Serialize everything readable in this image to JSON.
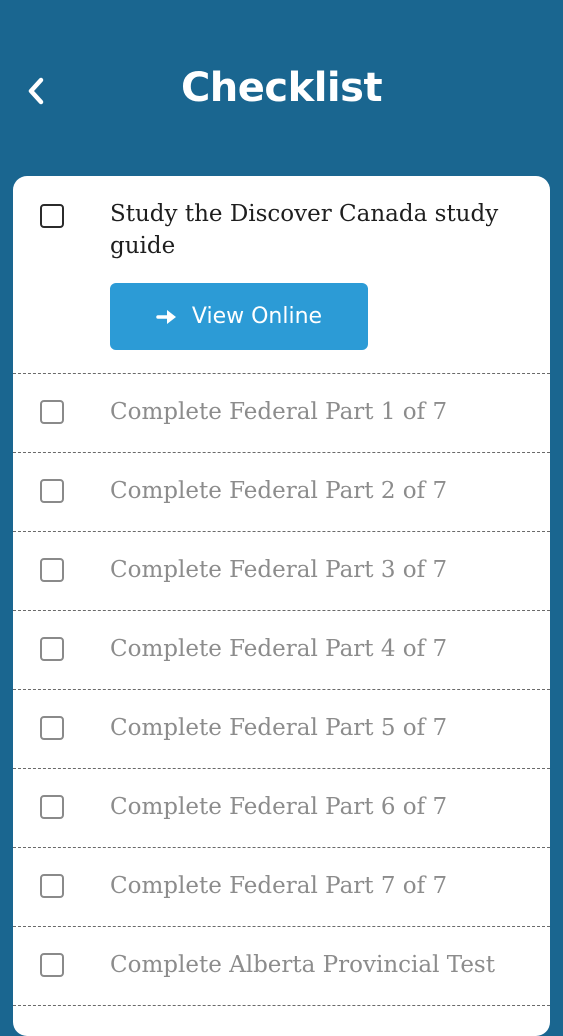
{
  "header": {
    "title": "Checklist",
    "back_icon": "chevron-left-icon"
  },
  "colors": {
    "background": "#1a6690",
    "card": "#ffffff",
    "button": "#2c9bd6",
    "text_primary": "#1e1e1e",
    "text_muted": "#8c8c8c"
  },
  "checklist": {
    "first": {
      "label": "Study the Discover Canada study guide",
      "button_label": "View Online",
      "button_icon": "arrow-right-icon",
      "checked": false
    },
    "items": [
      {
        "label": "Complete Federal Part 1 of 7",
        "checked": false
      },
      {
        "label": "Complete Federal Part 2 of 7",
        "checked": false
      },
      {
        "label": "Complete Federal Part 3 of 7",
        "checked": false
      },
      {
        "label": "Complete Federal Part 4 of 7",
        "checked": false
      },
      {
        "label": "Complete Federal Part 5 of 7",
        "checked": false
      },
      {
        "label": "Complete Federal Part 6 of 7",
        "checked": false
      },
      {
        "label": "Complete Federal Part 7 of 7",
        "checked": false
      },
      {
        "label": "Complete Alberta Provincial Test",
        "checked": false
      }
    ]
  }
}
